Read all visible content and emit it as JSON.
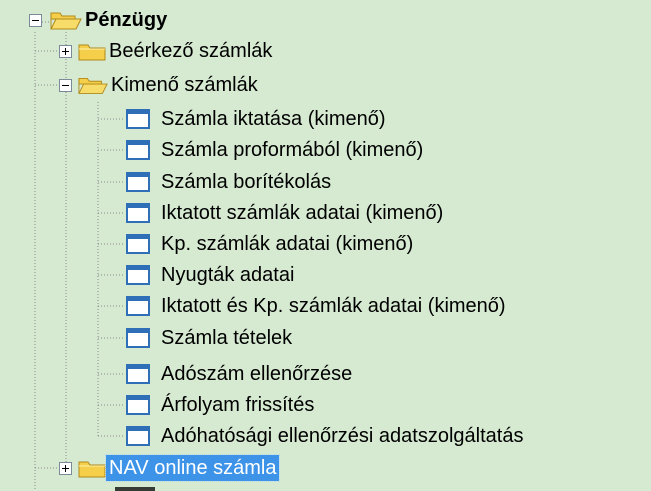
{
  "tree": {
    "root": {
      "label": "Pénzügy",
      "icon": "folder-open-icon",
      "expanded": true
    },
    "folders": [
      {
        "label": "Beérkező számlák",
        "icon": "folder-closed-icon",
        "expanded": false
      },
      {
        "label": "Kimenő számlák",
        "icon": "folder-open-icon",
        "expanded": true
      },
      {
        "label": "NAV online számla",
        "icon": "folder-closed-icon",
        "expanded": false,
        "selected": true
      }
    ],
    "items": [
      {
        "label": "Számla iktatása (kimenő)",
        "icon": "form-window-icon"
      },
      {
        "label": "Számla proformából (kimenő)",
        "icon": "form-window-icon"
      },
      {
        "label": "Számla borítékolás",
        "icon": "form-window-icon"
      },
      {
        "label": "Iktatott számlák adatai (kimenő)",
        "icon": "form-window-icon"
      },
      {
        "label": "Kp. számlák adatai (kimenő)",
        "icon": "form-window-icon"
      },
      {
        "label": "Nyugták adatai",
        "icon": "form-window-icon"
      },
      {
        "label": "Iktatott és Kp. számlák adatai (kimenő)",
        "icon": "form-window-icon"
      },
      {
        "label": "Számla tételek",
        "icon": "form-window-icon"
      },
      {
        "label": "Adószám ellenőrzése",
        "icon": "form-window-icon"
      },
      {
        "label": "Árfolyam frissítés",
        "icon": "form-window-icon"
      },
      {
        "label": "Adóhatósági ellenőrzési adatszolgáltatás",
        "icon": "form-window-icon"
      }
    ]
  },
  "colors": {
    "background": "#d6ead2",
    "selection": "#3c93e8",
    "folder": "#f5cf4a",
    "form_border": "#2f6fb8"
  }
}
